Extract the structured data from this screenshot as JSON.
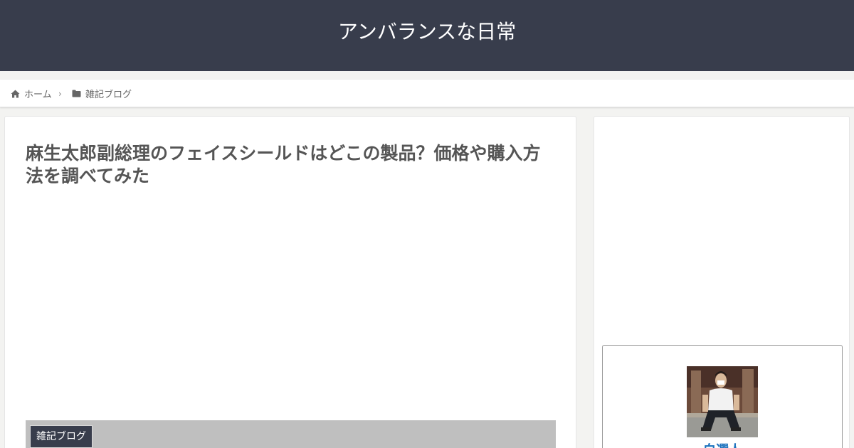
{
  "header": {
    "site_title": "アンバランスな日常"
  },
  "breadcrumb": {
    "home_label": "ホーム",
    "separator": "›",
    "category_label": "雑記ブログ"
  },
  "article": {
    "title": "麻生太郎副総理のフェイスシールドはどこの製品？価格や購入方法を調べてみた",
    "category_label": "雑記ブログ"
  },
  "sidebar": {
    "profile_name": "白選人"
  },
  "colors": {
    "header_bg": "#383d4c",
    "page_bg": "#f3f3f1",
    "link_blue": "#1e73be",
    "eyecatch_gray": "#bfbfbf"
  }
}
